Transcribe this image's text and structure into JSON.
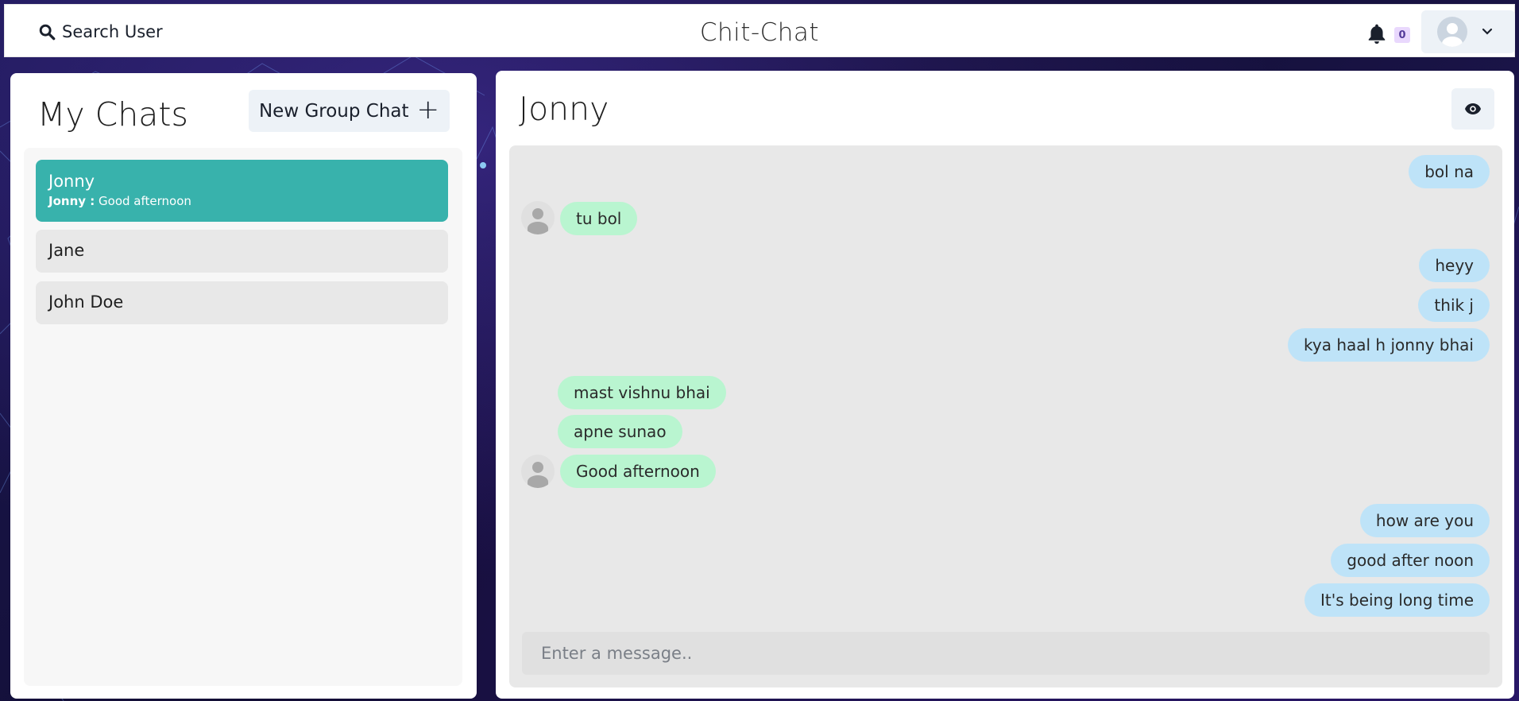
{
  "app": {
    "title": "Chit-Chat"
  },
  "header": {
    "search_label": "Search User",
    "notification_count": "0"
  },
  "sidebar": {
    "title": "My Chats",
    "new_group_label": "New Group Chat",
    "chats": [
      {
        "name": "Jonny",
        "latest_sender": "Jonny :",
        "latest_message": "Good afternoon",
        "active": true
      },
      {
        "name": "Jane"
      },
      {
        "name": "John Doe"
      }
    ]
  },
  "chat": {
    "title": "Jonny",
    "messages": [
      {
        "direction": "out",
        "text": "bol na"
      },
      {
        "direction": "in",
        "text": "tu bol",
        "avatar": true
      },
      {
        "direction": "out",
        "text": "heyy"
      },
      {
        "direction": "out",
        "text": "thik j"
      },
      {
        "direction": "out",
        "text": "kya haal h jonny bhai"
      },
      {
        "direction": "in",
        "text": "mast vishnu bhai"
      },
      {
        "direction": "in",
        "text": "apne sunao"
      },
      {
        "direction": "in",
        "text": "Good afternoon",
        "avatar": true
      },
      {
        "direction": "out",
        "text": "how are you"
      },
      {
        "direction": "out",
        "text": "good after noon"
      },
      {
        "direction": "out",
        "text": "It's being long time"
      }
    ],
    "input_placeholder": "Enter a message.."
  },
  "colors": {
    "active_chat": "#38b2ac",
    "outgoing_bubble": "#bee3f8",
    "incoming_bubble": "#b9f5d0",
    "badge_bg": "#e9d8fd"
  }
}
